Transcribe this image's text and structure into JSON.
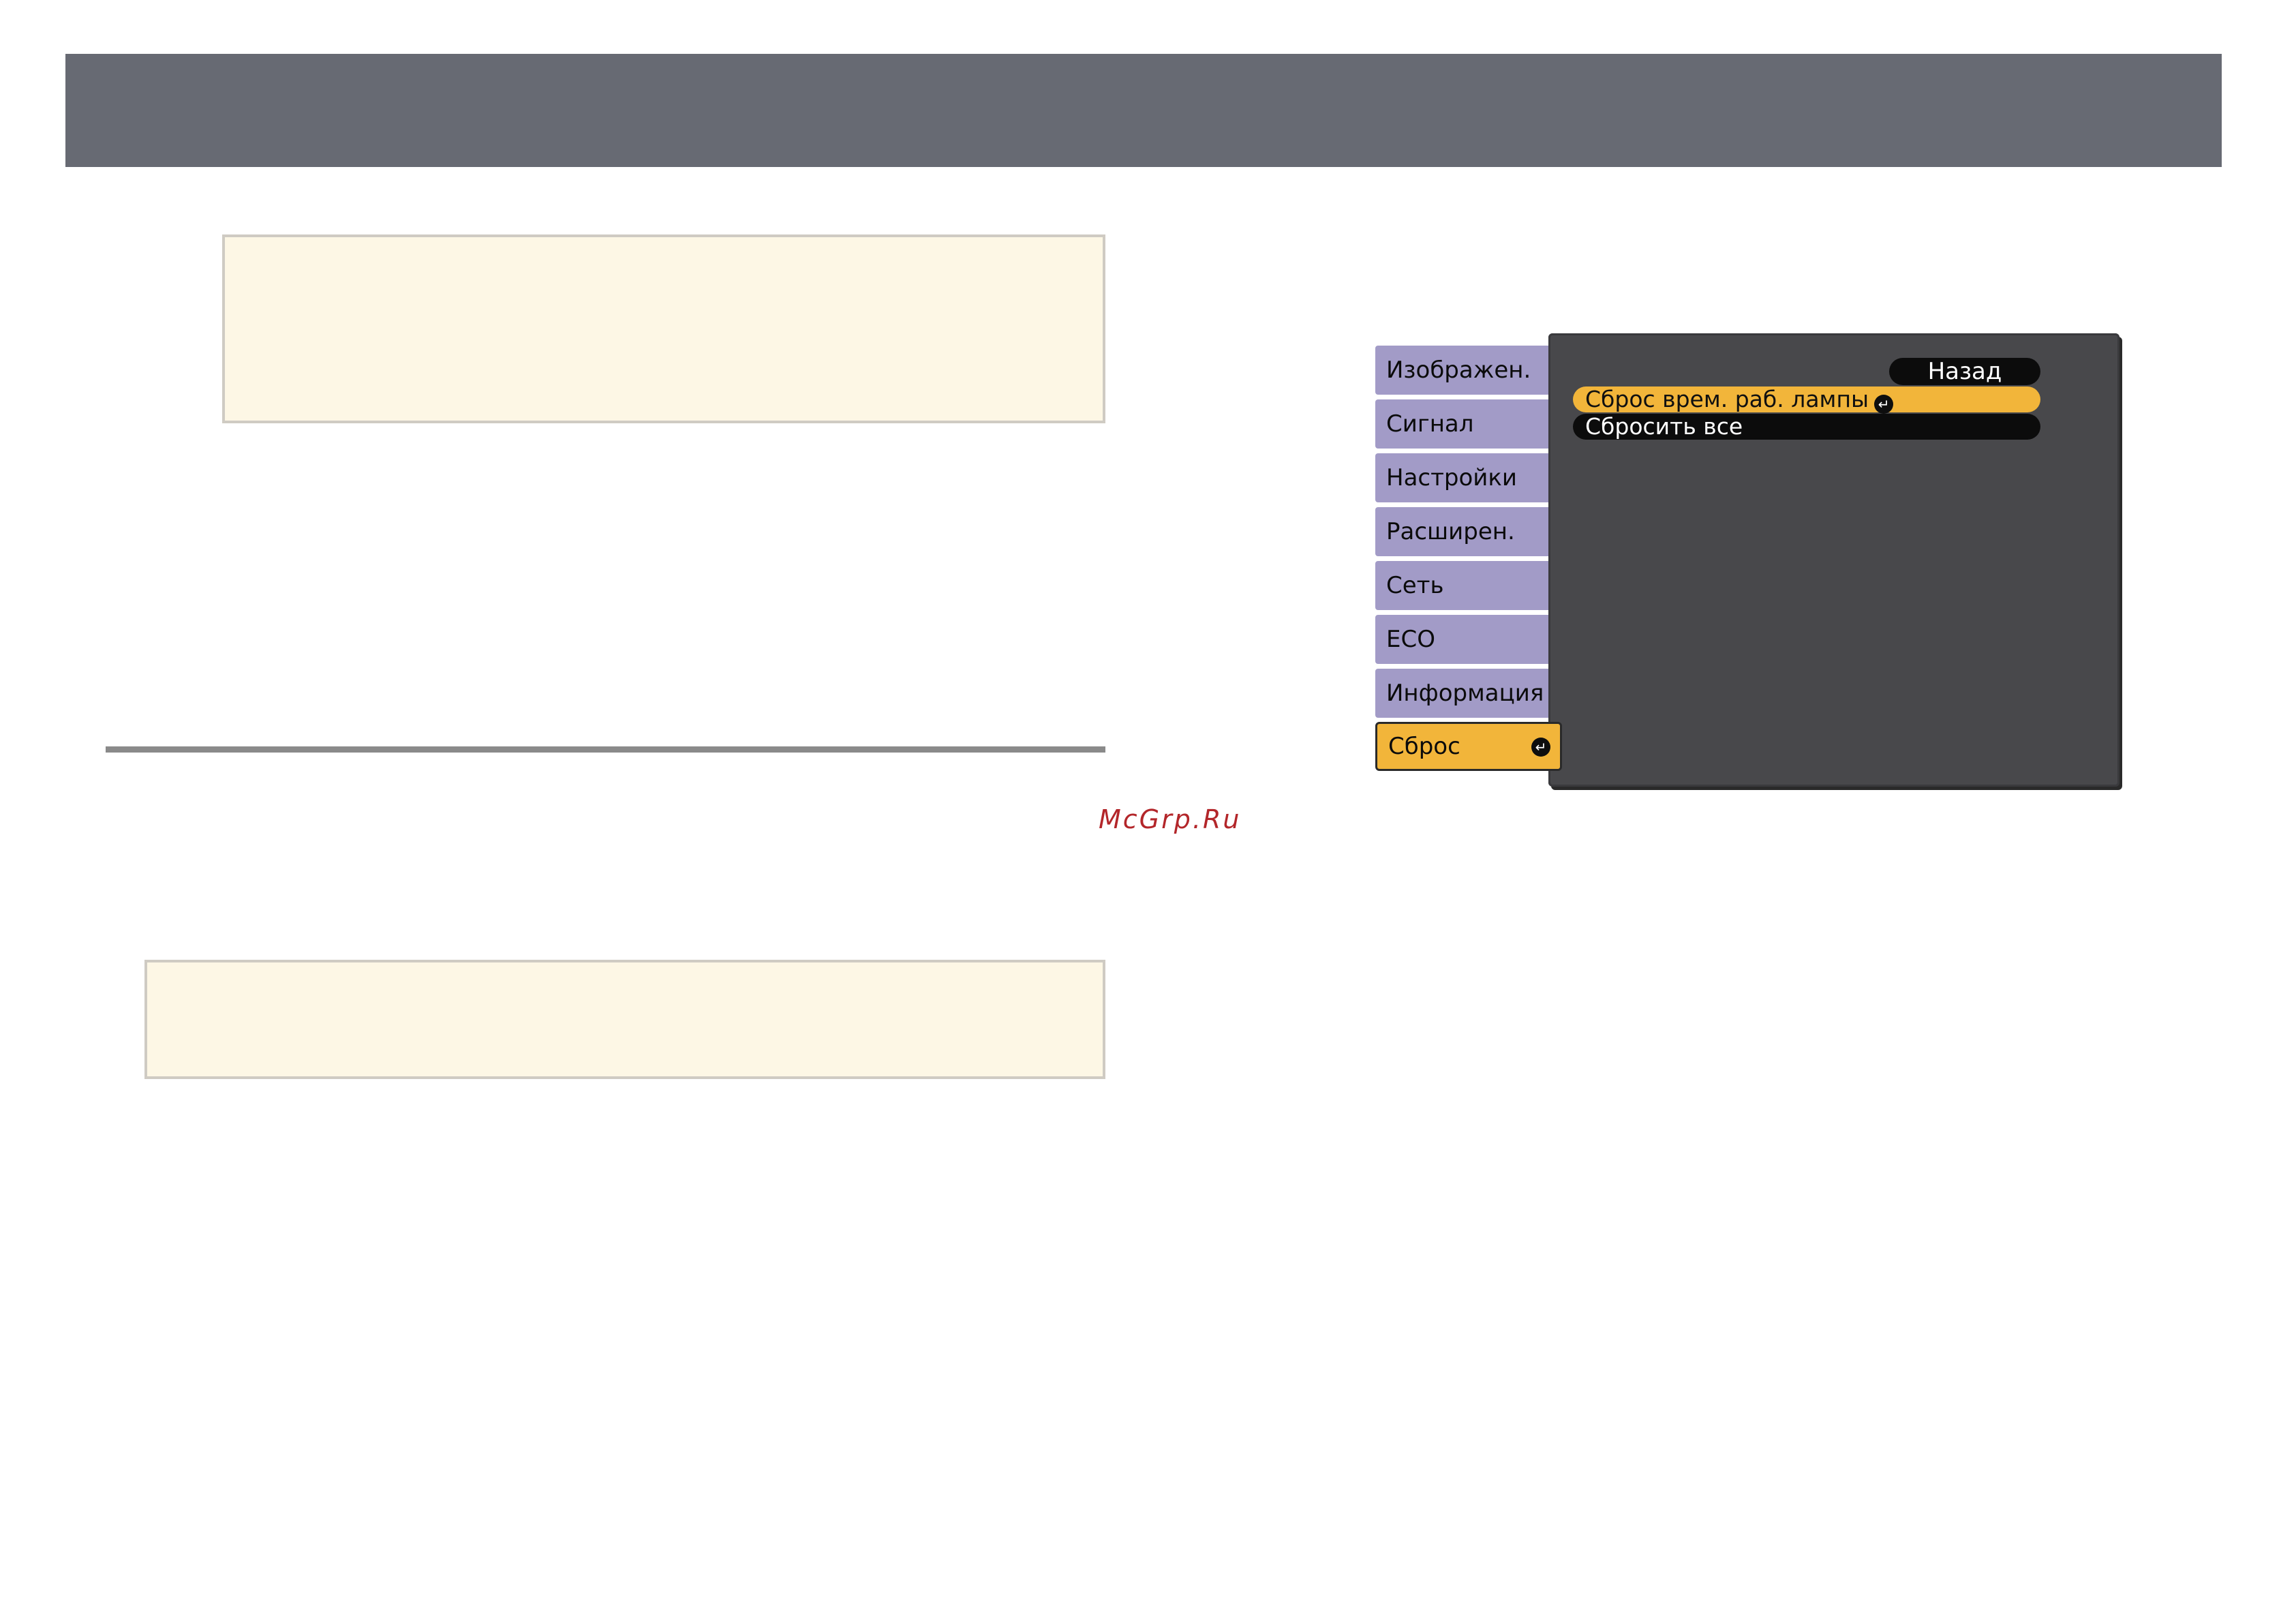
{
  "watermark": "McGrp.Ru",
  "menu": {
    "tabs": [
      {
        "label": "Изображен."
      },
      {
        "label": "Сигнал"
      },
      {
        "label": "Настройки"
      },
      {
        "label": "Расширен."
      },
      {
        "label": "Сеть"
      },
      {
        "label": "ECO"
      },
      {
        "label": "Информация"
      },
      {
        "label": "Сброс",
        "active": true
      }
    ],
    "back_label": "Назад",
    "items": [
      {
        "label": "Сброс врем. раб. лампы",
        "selected": true
      },
      {
        "label": "Сбросить все",
        "selected": false
      }
    ],
    "enter_glyph": "↵",
    "icons": {
      "enter": "enter-icon"
    }
  },
  "colors": {
    "header": "#676a73",
    "tab": "#a29bc7",
    "accent": "#f2b53a",
    "panel": "#48484b",
    "note_bg": "#fdf7e5",
    "watermark": "#b3262a"
  }
}
